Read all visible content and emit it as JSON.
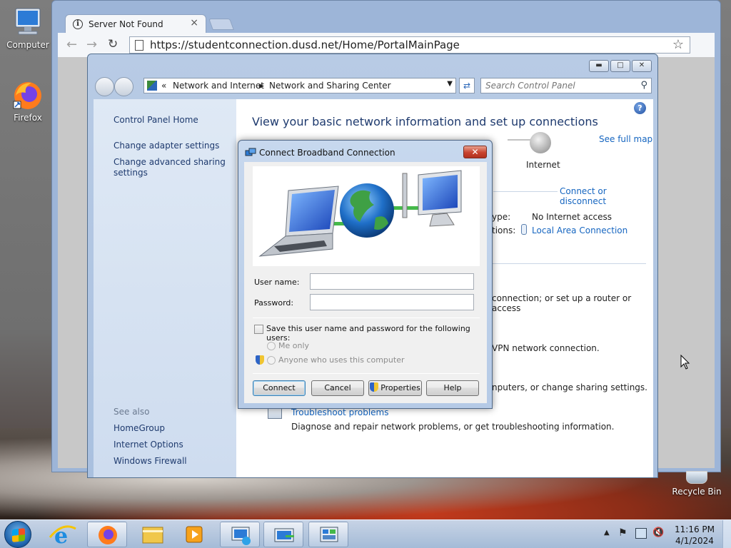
{
  "desktop": {
    "icons": [
      {
        "label": "Computer"
      },
      {
        "label": "Firefox"
      }
    ],
    "recycle_bin": "Recycle Bin"
  },
  "browser": {
    "tab_title": "Server Not Found",
    "tab_close": "×",
    "url": "https://studentconnection.dusd.net/Home/PortalMainPage"
  },
  "control_panel": {
    "breadcrumb": [
      "Network and Internet",
      "Network and Sharing Center"
    ],
    "breadcrumb_prefix": "«",
    "search_placeholder": "Search Control Panel",
    "left_links": [
      "Control Panel Home",
      "Change adapter settings",
      "Change advanced sharing settings"
    ],
    "see_also_label": "See also",
    "see_also": [
      "HomeGroup",
      "Internet Options",
      "Windows Firewall"
    ],
    "heading": "View your basic network information and set up connections",
    "see_full_map": "See full map",
    "internet_label": "Internet",
    "connect_disconnect": "Connect or disconnect",
    "access_type_label": "ype:",
    "access_type_value": "No Internet access",
    "connections_label": "tions:",
    "connections_value": "Local Area Connection",
    "text_router": "connection; or set up a router or access",
    "text_vpn": "VPN network connection.",
    "text_sharing": "nputers, or change sharing settings.",
    "troubleshoot_link": "Troubleshoot problems",
    "troubleshoot_desc": "Diagnose and repair network problems, or get troubleshooting information."
  },
  "dialog": {
    "title": "Connect Broadband Connection",
    "username_label": "User name:",
    "username_value": "",
    "password_label": "Password:",
    "password_value": "",
    "save_checkbox_label": "Save this user name and password for the following users:",
    "radio_me_only": "Me only",
    "radio_anyone": "Anyone who uses this computer",
    "buttons": {
      "connect": "Connect",
      "cancel": "Cancel",
      "properties": "Properties",
      "help": "Help"
    }
  },
  "taskbar": {
    "time": "11:16 PM",
    "date": "4/1/2024"
  }
}
